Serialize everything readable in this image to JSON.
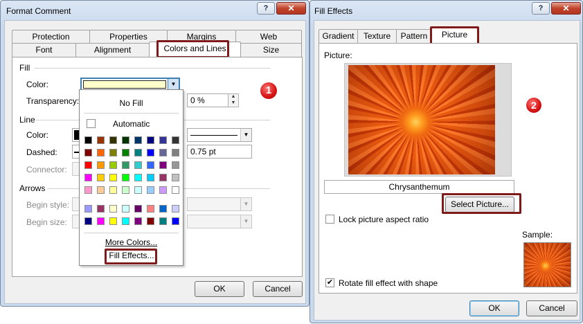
{
  "left_dialog": {
    "title": "Format Comment",
    "tabs_back": [
      "Protection",
      "Properties",
      "Margins",
      "Web"
    ],
    "tabs_front": [
      "Font",
      "Alignment",
      "Colors and Lines",
      "Size"
    ],
    "fill_section": "Fill",
    "color_label": "Color:",
    "transparency_label": "Transparency:",
    "transparency_value": "0 %",
    "line_section": "Line",
    "line_color_label": "Color:",
    "dashed_label": "Dashed:",
    "connector_label": "Connector:",
    "weight_value": "0.75 pt",
    "arrows_section": "Arrows",
    "begin_style_label": "Begin style:",
    "begin_size_label": "Begin size:",
    "ok": "OK",
    "cancel": "Cancel",
    "step_badge": "1",
    "fill_color": "#ffffcc"
  },
  "palette": {
    "no_fill": "No Fill",
    "automatic": "Automatic",
    "more_colors": "More Colors...",
    "fill_effects": "Fill Effects...",
    "rows": [
      [
        "#000000",
        "#993300",
        "#333300",
        "#003300",
        "#003366",
        "#000080",
        "#333399",
        "#333333"
      ],
      [
        "#800000",
        "#ff6600",
        "#808000",
        "#008000",
        "#008080",
        "#0000ff",
        "#666699",
        "#808080"
      ],
      [
        "#ff0000",
        "#ff9900",
        "#99cc00",
        "#339966",
        "#33cccc",
        "#3366ff",
        "#800080",
        "#969696"
      ],
      [
        "#ff00ff",
        "#ffcc00",
        "#ffff00",
        "#00ff00",
        "#00ffff",
        "#00ccff",
        "#993366",
        "#c0c0c0"
      ],
      [
        "#ff99cc",
        "#ffcc99",
        "#ffff99",
        "#ccffcc",
        "#ccffff",
        "#99ccff",
        "#cc99ff",
        "#ffffff"
      ]
    ],
    "rows2": [
      [
        "#9999ff",
        "#993366",
        "#ffffcc",
        "#ccffff",
        "#660066",
        "#ff8080",
        "#0066cc",
        "#ccccff"
      ],
      [
        "#000080",
        "#ff00ff",
        "#ffff00",
        "#00ffff",
        "#800080",
        "#800000",
        "#008080",
        "#0000ff"
      ]
    ]
  },
  "right_dialog": {
    "title": "Fill Effects",
    "tabs": [
      "Gradient",
      "Texture",
      "Pattern",
      "Picture"
    ],
    "picture_label": "Picture:",
    "picture_name": "Chrysanthemum",
    "select_picture": "Select Picture...",
    "lock_aspect": "Lock picture aspect ratio",
    "lock_checked": false,
    "rotate_fill": "Rotate fill effect with shape",
    "rotate_checked": true,
    "sample_label": "Sample:",
    "ok": "OK",
    "cancel": "Cancel",
    "step_badge": "2"
  },
  "colors": {
    "highlight_box": "#7f1a1a",
    "badge": "#d81818"
  }
}
